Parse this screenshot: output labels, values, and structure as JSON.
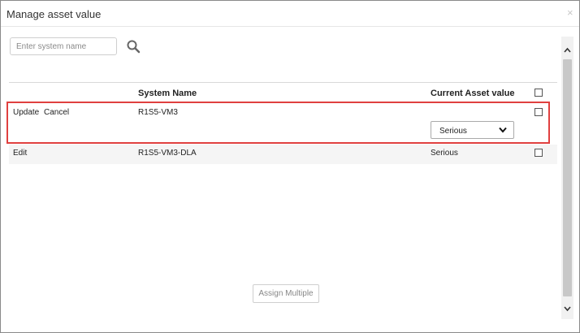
{
  "dialog": {
    "title": "Manage asset value",
    "close_glyph": "×"
  },
  "search": {
    "placeholder": "Enter system name"
  },
  "table": {
    "headers": {
      "system_name": "System Name",
      "current_asset_value": "Current Asset value"
    },
    "rows": [
      {
        "actions": [
          "Update",
          "Cancel"
        ],
        "system_name": "R1S5-VM3",
        "asset_value_select": "Serious",
        "editing": true
      },
      {
        "action": "Edit",
        "system_name": "R1S5-VM3-DLA",
        "asset_value": "Serious"
      }
    ]
  },
  "footer": {
    "assign_multiple_label": "Assign Multiple"
  },
  "colors": {
    "highlight_border": "#e0403f",
    "row_alt_bg": "#f5f5f5"
  },
  "icons": {
    "search": "search-icon",
    "close": "close-icon",
    "dropdown": "chevron-down-icon"
  }
}
